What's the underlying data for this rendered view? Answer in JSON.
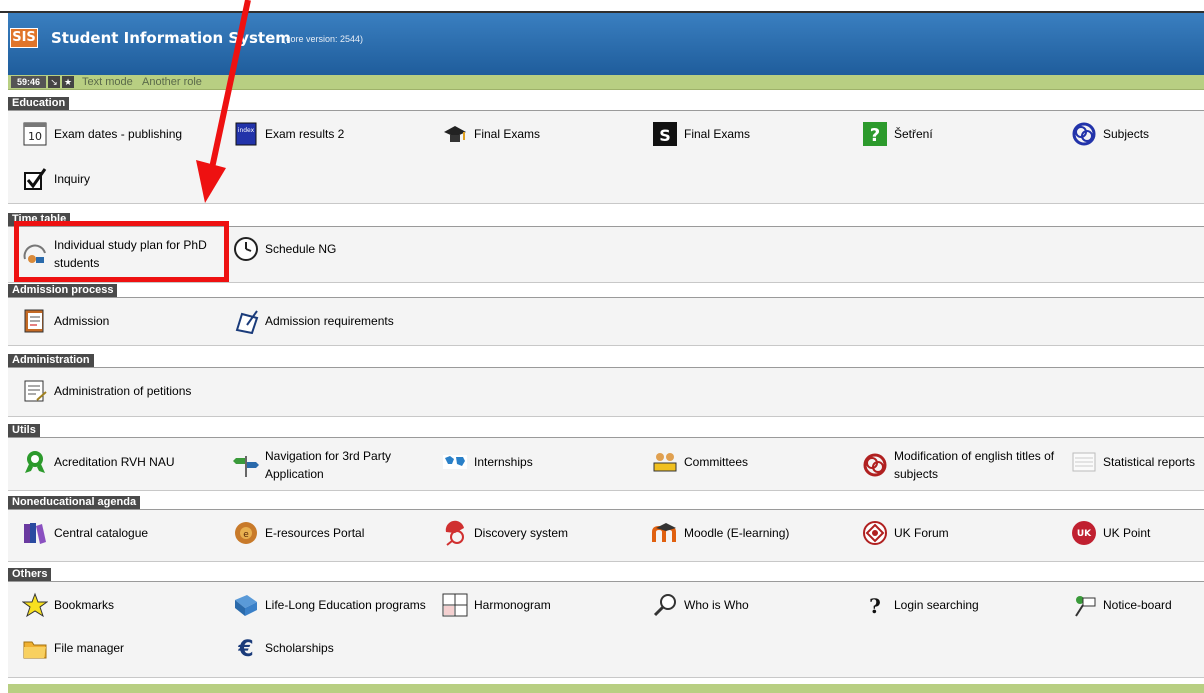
{
  "header": {
    "logo": "SIS",
    "title": "Student Information System",
    "version": "(core version: 2544)"
  },
  "toolbar": {
    "timer": "59:46",
    "text_mode": "Text mode",
    "another_role": "Another role"
  },
  "sections": {
    "education": {
      "label": "Education",
      "items": [
        {
          "label": "Exam dates - publishing",
          "icon": "calendar-icon"
        },
        {
          "label": "Exam results 2",
          "icon": "index-book-icon"
        },
        {
          "label": "Final Exams",
          "icon": "graduation-cap-icon"
        },
        {
          "label": "Final Exams",
          "icon": "final-exams-sf-icon"
        },
        {
          "label": "Šetření",
          "icon": "question-box-icon"
        },
        {
          "label": "Subjects",
          "icon": "subjects-knot-icon"
        },
        {
          "label": "Inquiry",
          "icon": "checkbox-icon"
        }
      ]
    },
    "timetable": {
      "label": "Time table",
      "items": [
        {
          "label": "Individual study plan for PhD students",
          "icon": "study-plan-icon"
        },
        {
          "label": "Schedule NG",
          "icon": "clock-icon"
        }
      ]
    },
    "admission": {
      "label": "Admission process",
      "items": [
        {
          "label": "Admission",
          "icon": "admission-form-icon"
        },
        {
          "label": "Admission requirements",
          "icon": "pen-paper-icon"
        }
      ]
    },
    "administration": {
      "label": "Administration",
      "items": [
        {
          "label": "Administration of petitions",
          "icon": "petition-document-icon"
        }
      ]
    },
    "utils": {
      "label": "Utils",
      "items": [
        {
          "label": "Acreditation RVH NAU",
          "icon": "award-ribbon-icon"
        },
        {
          "label": "Navigation for 3rd Party Application",
          "icon": "signpost-icon"
        },
        {
          "label": "Internships",
          "icon": "world-map-icon"
        },
        {
          "label": "Committees",
          "icon": "committee-people-icon"
        },
        {
          "label": "Modification of english titles of subjects",
          "icon": "knot-red-icon"
        },
        {
          "label": "Statistical reports",
          "icon": "report-sheet-icon"
        }
      ]
    },
    "noneducational": {
      "label": "Noneducational agenda",
      "items": [
        {
          "label": "Central catalogue",
          "icon": "books-icon"
        },
        {
          "label": "E-resources Portal",
          "icon": "e-resources-icon"
        },
        {
          "label": "Discovery system",
          "icon": "discovery-icon"
        },
        {
          "label": "Moodle (E-learning)",
          "icon": "moodle-icon"
        },
        {
          "label": "UK Forum",
          "icon": "uk-forum-icon"
        },
        {
          "label": "UK Point",
          "icon": "uk-point-icon"
        }
      ]
    },
    "others": {
      "label": "Others",
      "items": [
        {
          "label": "Bookmarks",
          "icon": "star-icon"
        },
        {
          "label": "Life-Long Education programs",
          "icon": "lifelong-book-icon"
        },
        {
          "label": "Harmonogram",
          "icon": "harmonogram-calendar-icon"
        },
        {
          "label": "Who is Who",
          "icon": "magnifier-icon"
        },
        {
          "label": "Login searching",
          "icon": "question-mark-icon"
        },
        {
          "label": "Notice-board",
          "icon": "notice-board-icon"
        },
        {
          "label": "File manager",
          "icon": "folder-icon"
        },
        {
          "label": "Scholarships",
          "icon": "euro-icon"
        }
      ]
    }
  },
  "colors": {
    "header": "#2a6aab",
    "toolbar": "#b8cf82",
    "section_label": "#4a4a4a",
    "highlight": "#ee1111"
  }
}
